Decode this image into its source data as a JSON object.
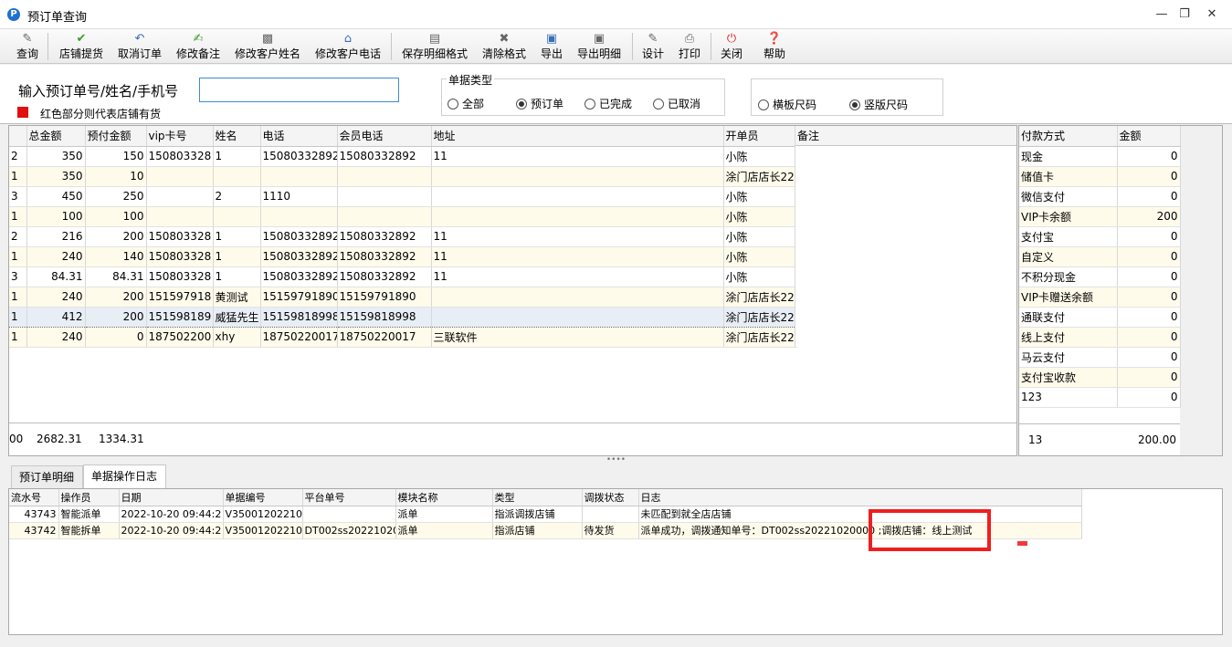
{
  "window": {
    "title": "预订单查询",
    "icon_letter": "P"
  },
  "toolbar": {
    "buttons": [
      {
        "label": "查询",
        "icon": "eraser-icon"
      },
      {
        "label": "店铺提货",
        "icon": "check-icon"
      },
      {
        "label": "取消订单",
        "icon": "undo-icon"
      },
      {
        "label": "修改备注",
        "icon": "edit-note-icon"
      },
      {
        "label": "修改客户姓名",
        "icon": "id-card-icon"
      },
      {
        "label": "修改客户电话",
        "icon": "home-icon"
      },
      {
        "label": "保存明细格式",
        "icon": "save-layout-icon"
      },
      {
        "label": "清除格式",
        "icon": "clear-icon"
      },
      {
        "label": "导出",
        "icon": "export-icon"
      },
      {
        "label": "导出明细",
        "icon": "export-detail-icon"
      },
      {
        "label": "设计",
        "icon": "design-icon"
      },
      {
        "label": "打印",
        "icon": "printer-icon"
      },
      {
        "label": "关闭",
        "icon": "power-icon"
      },
      {
        "label": "帮助",
        "icon": "help-icon"
      }
    ]
  },
  "search": {
    "label": "输入预订单号/姓名/手机号",
    "value": "",
    "note": "红色部分则代表店铺有货",
    "note_color": "#e01010"
  },
  "doc_type": {
    "title": "单据类型",
    "options": [
      "全部",
      "预订单",
      "已完成",
      "已取消"
    ],
    "selected": "预订单"
  },
  "size_mode": {
    "options": [
      "横板尺码",
      "竖版尺码"
    ],
    "selected": "竖版尺码"
  },
  "main_grid": {
    "columns": [
      "",
      "总金额",
      "预付金额",
      "vip卡号",
      "姓名",
      "电话",
      "会员电话",
      "地址",
      "开单员",
      "备注"
    ],
    "rows": [
      [
        "2",
        "350",
        "150",
        "150803328",
        "1",
        "15080332892",
        "15080332892",
        "11",
        "小陈",
        ""
      ],
      [
        "1",
        "350",
        "10",
        "",
        "",
        "",
        "",
        "",
        "涂门店店长22",
        ""
      ],
      [
        "3",
        "450",
        "250",
        "",
        "2",
        "1110",
        "",
        "",
        "小陈",
        ""
      ],
      [
        "1",
        "100",
        "100",
        "",
        "",
        "",
        "",
        "",
        "小陈",
        ""
      ],
      [
        "2",
        "216",
        "200",
        "150803328",
        "1",
        "15080332892",
        "15080332892",
        "11",
        "小陈",
        ""
      ],
      [
        "1",
        "240",
        "140",
        "150803328",
        "1",
        "15080332892",
        "15080332892",
        "11",
        "小陈",
        ""
      ],
      [
        "3",
        "84.31",
        "84.31",
        "150803328",
        "1",
        "15080332892",
        "15080332892",
        "11",
        "小陈",
        ""
      ],
      [
        "1",
        "240",
        "200",
        "151597918",
        "黄测试",
        "15159791890",
        "15159791890",
        "",
        "涂门店店长22",
        ""
      ],
      [
        "1",
        "412",
        "200",
        "151598189",
        "威猛先生",
        "15159818998",
        "15159818998",
        "",
        "涂门店店长22",
        ""
      ],
      [
        "1",
        "240",
        "0",
        "187502200",
        "xhy",
        "18750220017",
        "18750220017",
        "三联软件",
        "涂门店店长22",
        ""
      ]
    ],
    "totals": {
      "lead": "00",
      "total_amount": "2682.31",
      "prepaid": "1334.31"
    }
  },
  "payment_grid": {
    "columns": [
      "付款方式",
      "金额"
    ],
    "rows": [
      [
        "现金",
        "0"
      ],
      [
        "储值卡",
        "0"
      ],
      [
        "微信支付",
        "0"
      ],
      [
        "VIP卡余额",
        "200"
      ],
      [
        "支付宝",
        "0"
      ],
      [
        "自定义",
        "0"
      ],
      [
        "不积分现金",
        "0"
      ],
      [
        "VIP卡赠送余额",
        "0"
      ],
      [
        "通联支付",
        "0"
      ],
      [
        "线上支付",
        "0"
      ],
      [
        "马云支付",
        "0"
      ],
      [
        "支付宝收款",
        "0"
      ],
      [
        "123",
        "0"
      ]
    ],
    "totals": {
      "count": "13",
      "amount": "200.00"
    }
  },
  "splitter": {
    "grip": "••••"
  },
  "tabs": [
    "预订单明细",
    "单据操作日志"
  ],
  "active_tab": "单据操作日志",
  "log_grid": {
    "columns": [
      "流水号",
      "操作员",
      "日期",
      "单据编号",
      "平台单号",
      "模块名称",
      "类型",
      "调拨状态",
      "日志"
    ],
    "rows": [
      [
        "43743",
        "智能派单",
        "2022-10-20 09:44:2",
        "V350012022102",
        "",
        "派单",
        "指派调拨店铺",
        "",
        "未匹配到就全店店铺"
      ],
      [
        "43742",
        "智能拆单",
        "2022-10-20 09:44:2",
        "V350012022102",
        "DT002ss2022102000",
        "派单",
        "指派店铺",
        "待发货",
        "派单成功，调拨通知单号：DT002ss20221020000 ;调拨店铺：线上测试"
      ]
    ]
  },
  "colors": {
    "highlight": "#ee1f1f",
    "input_border": "#3c8ccf",
    "alt_row": "#fffbeb"
  }
}
